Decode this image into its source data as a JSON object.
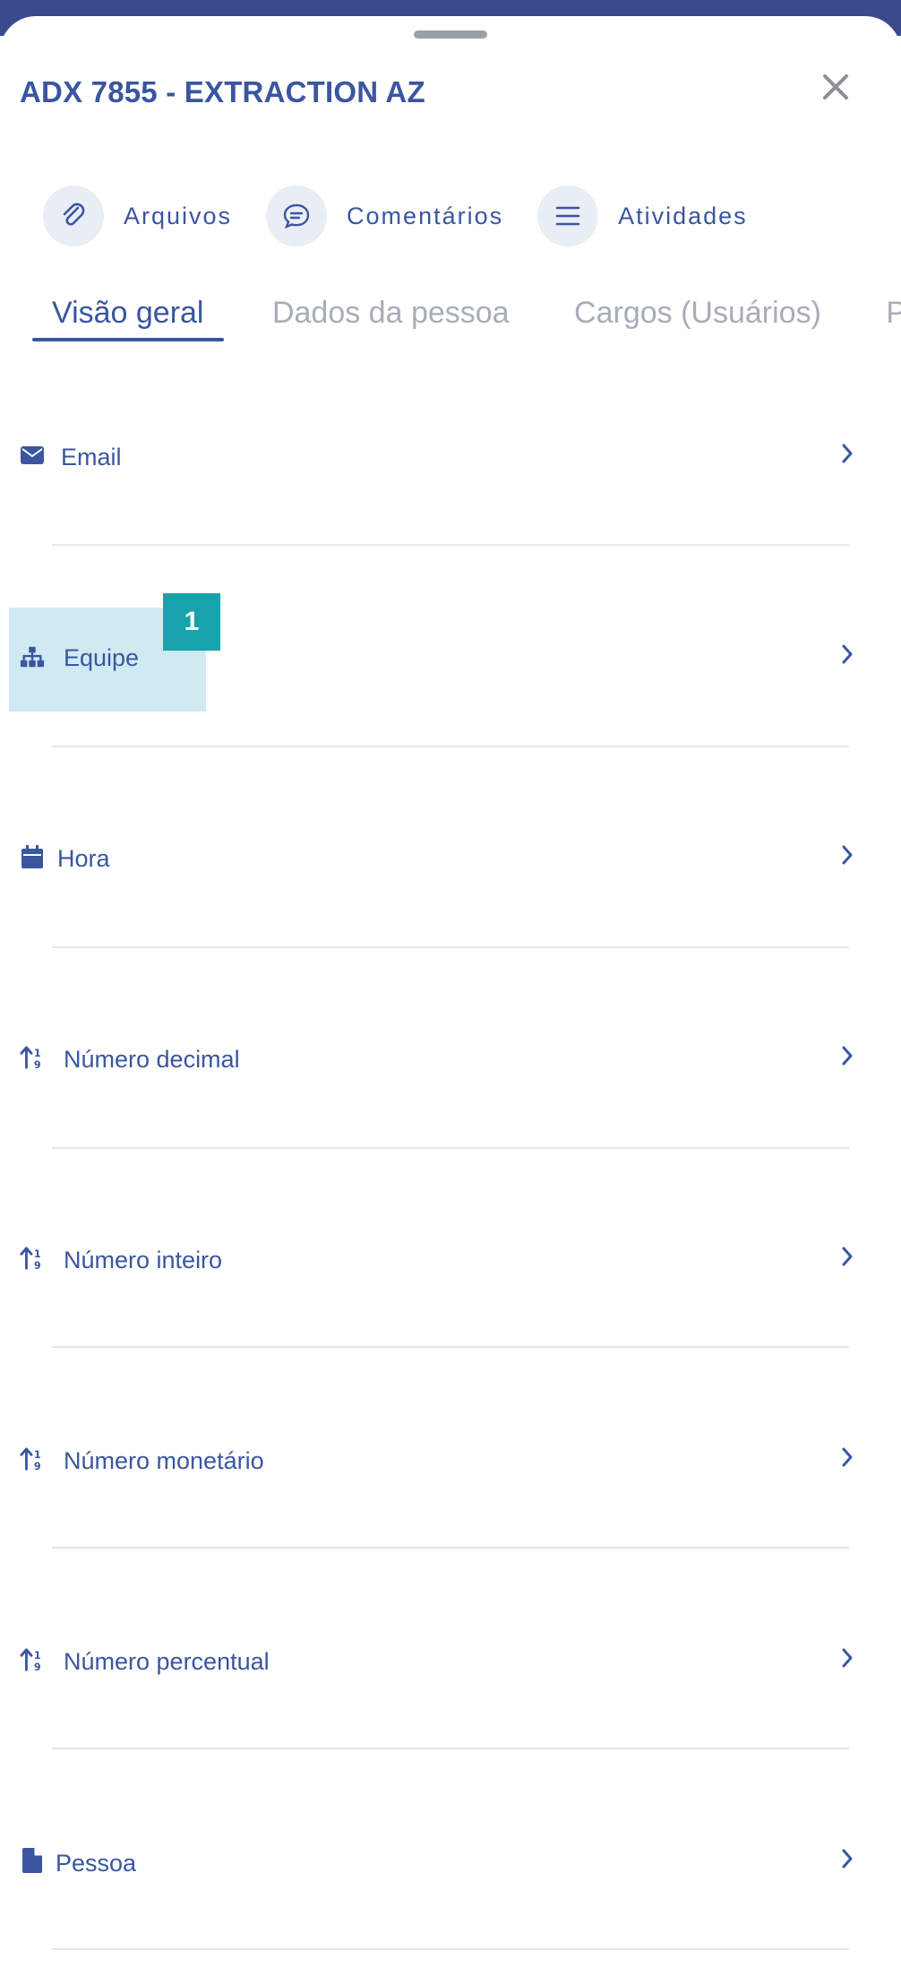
{
  "header": {
    "title": "ADX 7855 - EXTRACTION AZ"
  },
  "actions": [
    {
      "label": "Arquivos",
      "icon": "paperclip-icon"
    },
    {
      "label": "Comentários",
      "icon": "comment-icon"
    },
    {
      "label": "Atividades",
      "icon": "list-icon"
    }
  ],
  "tabs": [
    {
      "label": "Visão geral",
      "active": true
    },
    {
      "label": "Dados da pessoa",
      "active": false
    },
    {
      "label": "Cargos (Usuários)",
      "active": false
    },
    {
      "label": "Pe",
      "active": false
    }
  ],
  "fields": [
    {
      "label": "Email",
      "icon": "envelope-icon"
    },
    {
      "label": "Equipe",
      "icon": "sitemap-icon"
    },
    {
      "label": "Hora",
      "icon": "calendar-icon"
    },
    {
      "label": "Número decimal",
      "icon": "sort-numeric-icon"
    },
    {
      "label": "Número inteiro",
      "icon": "sort-numeric-icon"
    },
    {
      "label": "Número monetário",
      "icon": "sort-numeric-icon"
    },
    {
      "label": "Número percentual",
      "icon": "sort-numeric-icon"
    },
    {
      "label": "Pessoa",
      "icon": "file-icon"
    }
  ],
  "annotation": {
    "badge": "1"
  },
  "colors": {
    "primary": "#3a56a0",
    "inactive_tab": "#a7adb8",
    "highlight": "#cfeaf0",
    "badge": "#17a3ab",
    "top_band": "#3b4a8c"
  }
}
